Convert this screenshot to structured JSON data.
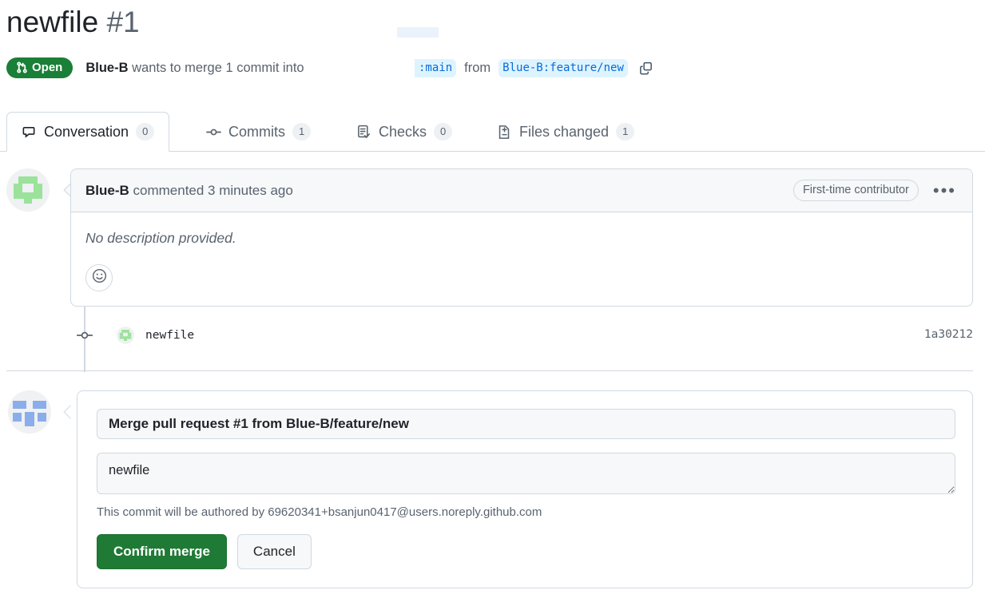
{
  "header": {
    "title": "newfile",
    "number": "#1",
    "state_label": "Open",
    "state_icon": "git-pull-request-icon",
    "state_color": "#1a7f37",
    "meta_author": "Blue-B",
    "meta_text": " wants to merge 1 commit into",
    "base_branch": ":main",
    "from_word": "from",
    "head_branch": "Blue-B:feature/new",
    "copy_icon": "copy-icon",
    "branch_chip_bg": "#ddf4ff",
    "branch_chip_fg": "#0969da"
  },
  "tabs": [
    {
      "label": "Conversation",
      "count": "0",
      "icon": "comment-discussion-icon",
      "active": true
    },
    {
      "label": "Commits",
      "count": "1",
      "icon": "git-commit-icon",
      "active": false
    },
    {
      "label": "Checks",
      "count": "0",
      "icon": "checklist-icon",
      "active": false
    },
    {
      "label": "Files changed",
      "count": "1",
      "icon": "file-diff-icon",
      "active": false
    }
  ],
  "comment": {
    "author": "Blue-B",
    "action_text": " commented 3 minutes ago",
    "badge": "First-time contributor",
    "menu_icon": "kebab-horizontal-icon",
    "menu_glyph": "•••",
    "body": "No description provided.",
    "reaction_icon": "smiley-icon",
    "avatar_color": "#9be29b"
  },
  "commit": {
    "icon": "git-commit-icon",
    "message": "newfile",
    "sha": "1a30212",
    "avatar_color": "#9be29b"
  },
  "merge": {
    "avatar_color": "#8badea",
    "title_value": "Merge pull request #1 from Blue-B/feature/new",
    "title_placeholder": "Commit title",
    "description_value": "newfile",
    "description_placeholder": "Add an optional extended description...",
    "authored_note": "This commit will be authored by 69620341+bsanjun0417@users.noreply.github.com",
    "confirm_label": "Confirm merge",
    "cancel_label": "Cancel",
    "confirm_color": "#1f7a35"
  }
}
